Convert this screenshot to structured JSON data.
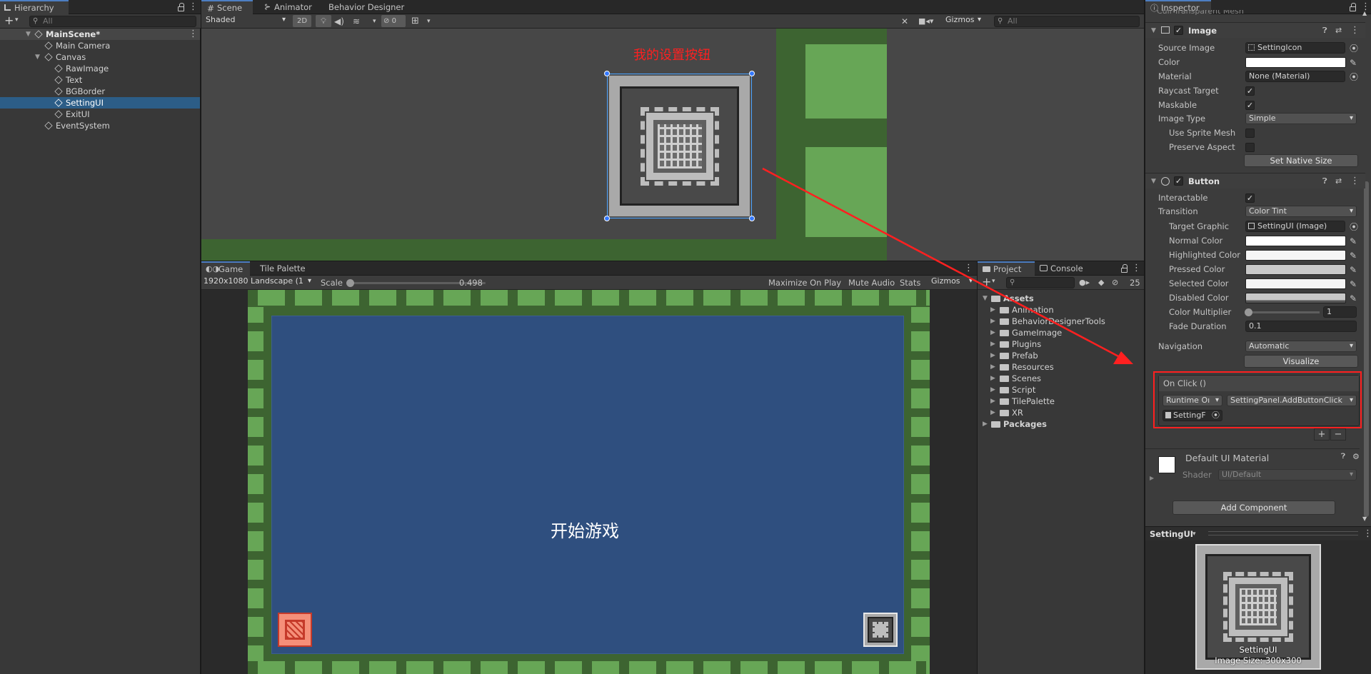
{
  "hierarchy": {
    "tab": "Hierarchy",
    "add_label": "+",
    "search_placeholder": "All",
    "scene": "MainScene*",
    "items": [
      {
        "label": "Main Camera"
      },
      {
        "label": "Canvas"
      },
      {
        "label": "RawImage"
      },
      {
        "label": "Text"
      },
      {
        "label": "BGBorder"
      },
      {
        "label": "SettingUI"
      },
      {
        "label": "ExitUI"
      },
      {
        "label": "EventSystem"
      }
    ]
  },
  "scene_view": {
    "tabs": [
      "Scene",
      "Animator",
      "Behavior Designer"
    ],
    "shading_mode": "Shaded",
    "btn_2d": "2D",
    "hidden_count": "0",
    "gizmos": "Gizmos",
    "search_placeholder": "All",
    "annotation": "我的设置按钮"
  },
  "game_view": {
    "tabs": [
      "Game",
      "Tile Palette"
    ],
    "resolution": "1920x1080 Landscape (1",
    "scale_label": "Scale",
    "scale_value": "0.498",
    "scale_fraction": 0.0,
    "maximize": "Maximize On Play",
    "mute": "Mute Audio",
    "stats": "Stats",
    "gizmos": "Gizmos",
    "start_text": "开始游戏"
  },
  "project": {
    "tabs": [
      "Project",
      "Console"
    ],
    "hidden_count": "25",
    "assets_root": "Assets",
    "folders": [
      "Animation",
      "BehaviorDesignerTools",
      "GameImage",
      "Plugins",
      "Prefab",
      "Resources",
      "Scenes",
      "Script",
      "TilePalette",
      "XR"
    ],
    "packages": "Packages"
  },
  "inspector": {
    "tab": "Inspector",
    "cut_off_top": "Cull Transparent Mesh",
    "image_component": {
      "title": "Image",
      "source_image_label": "Source Image",
      "source_image_value": "SettingIcon",
      "color_label": "Color",
      "material_label": "Material",
      "material_value": "None (Material)",
      "raycast_label": "Raycast Target",
      "maskable_label": "Maskable",
      "image_type_label": "Image Type",
      "image_type_value": "Simple",
      "use_sprite_mesh_label": "Use Sprite Mesh",
      "preserve_aspect_label": "Preserve Aspect",
      "native_size_button": "Set Native Size"
    },
    "button_component": {
      "title": "Button",
      "interactable_label": "Interactable",
      "transition_label": "Transition",
      "transition_value": "Color Tint",
      "target_graphic_label": "Target Graphic",
      "target_graphic_value": "SettingUI (Image)",
      "normal_color_label": "Normal Color",
      "highlighted_color_label": "Highlighted Color",
      "pressed_color_label": "Pressed Color",
      "selected_color_label": "Selected Color",
      "disabled_color_label": "Disabled Color",
      "color_multiplier_label": "Color Multiplier",
      "color_multiplier_value": "1",
      "fade_duration_label": "Fade Duration",
      "fade_duration_value": "0.1",
      "navigation_label": "Navigation",
      "navigation_value": "Automatic",
      "visualize_button": "Visualize",
      "on_click_title": "On Click ()",
      "runtime_value": "Runtime Oı",
      "function_value": "SettingPanel.AddButtonClick",
      "object_value": "SettingF",
      "plus": "+",
      "minus": "−"
    },
    "material": {
      "name": "Default UI Material",
      "shader_label": "Shader",
      "shader_value": "UI/Default"
    },
    "add_component": "Add Component",
    "preview": {
      "object_name": "SettingUI",
      "caption_name": "SettingUI",
      "caption_size": "Image Size: 300x300"
    }
  },
  "colors": {
    "selection": "#2c5d87",
    "annotation_red": "#ff2020",
    "game_blue": "#2f4f7f",
    "tile_green": "#67a656",
    "dark_green": "#3d6431"
  }
}
